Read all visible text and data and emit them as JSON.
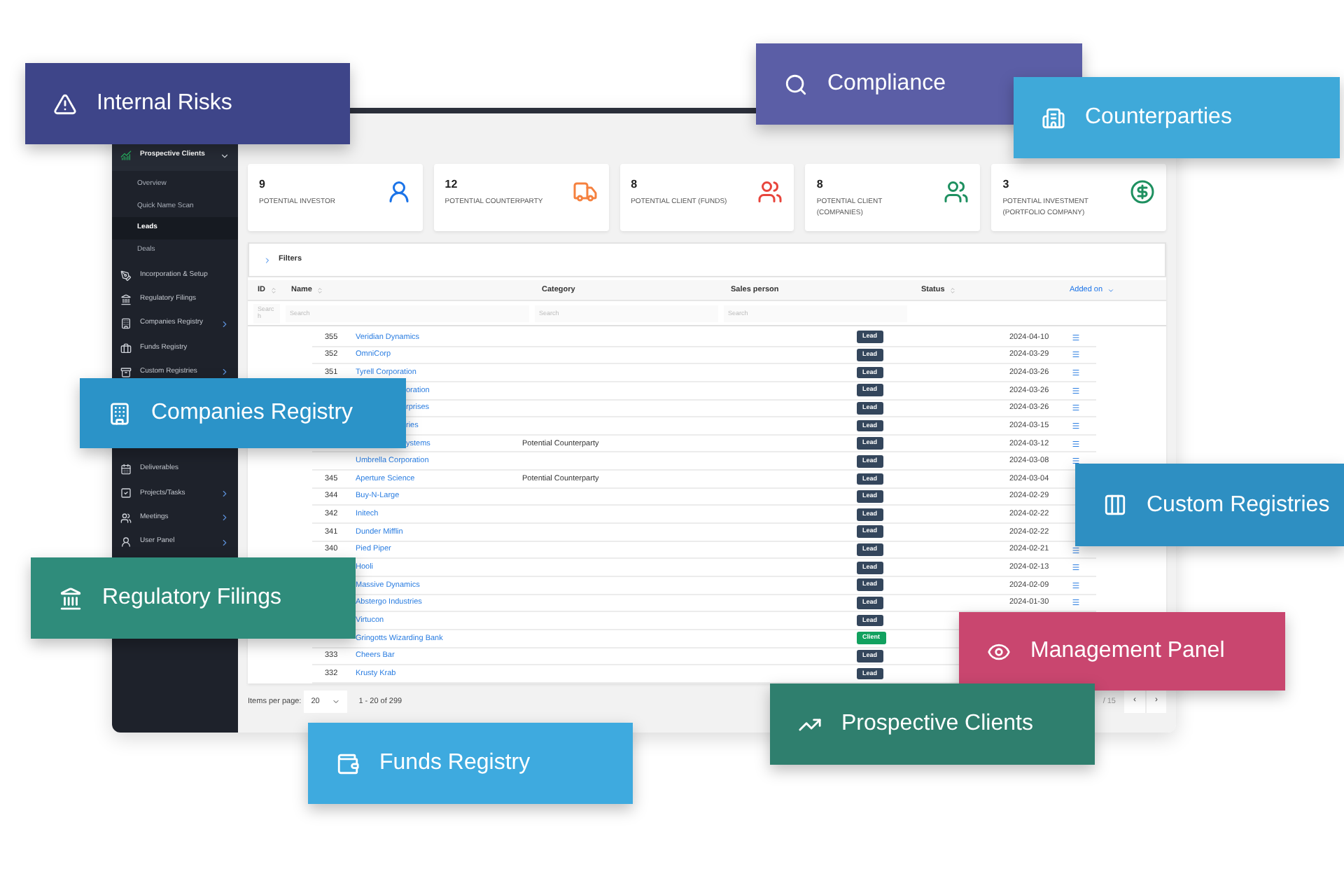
{
  "sidebar": {
    "items": [
      {
        "label": "Prospective Clients",
        "expandable": true,
        "expanded": true,
        "children": [
          {
            "label": "Overview",
            "selected": false
          },
          {
            "label": "Quick Name Scan",
            "selected": false
          },
          {
            "label": "Leads",
            "selected": true
          },
          {
            "label": "Deals",
            "selected": false
          }
        ]
      },
      {
        "label": "Incorporation & Setup",
        "expandable": false,
        "expanded": false
      },
      {
        "label": "Regulatory Filings",
        "expandable": false,
        "expanded": false
      },
      {
        "label": "Companies Registry",
        "expandable": true,
        "expanded": false
      },
      {
        "label": "Funds Registry",
        "expandable": false,
        "expanded": false
      },
      {
        "label": "Custom Registries",
        "expandable": true,
        "expanded": false
      }
    ],
    "bottom_items": [
      {
        "label": "Deliverables",
        "expandable": false,
        "expanded": false
      },
      {
        "label": "Projects/Tasks",
        "expandable": true,
        "expanded": false
      },
      {
        "label": "Meetings",
        "expandable": true,
        "expanded": false
      },
      {
        "label": "User Panel",
        "expandable": true,
        "expanded": false
      }
    ]
  },
  "stats": [
    {
      "value": "9",
      "label": "POTENTIAL INVESTOR"
    },
    {
      "value": "12",
      "label": "POTENTIAL COUNTERPARTY"
    },
    {
      "value": "8",
      "label": "POTENTIAL CLIENT (FUNDS)"
    },
    {
      "value": "8",
      "label": "POTENTIAL CLIENT (COMPANIES)"
    },
    {
      "value": "3",
      "label": "POTENTIAL INVESTMENT (PORTFOLIO COMPANY)"
    }
  ],
  "filters": {
    "label": "Filters",
    "expanded": false
  },
  "table": {
    "columns": [
      {
        "label": "ID",
        "sortable": true,
        "sorted": false,
        "placeholder": "Search"
      },
      {
        "label": "Name",
        "sortable": true,
        "sorted": false,
        "placeholder": "Search"
      },
      {
        "label": "Category",
        "sortable": false,
        "sorted": false,
        "placeholder": "Search"
      },
      {
        "label": "Sales person",
        "sortable": false,
        "sorted": false,
        "placeholder": "Search"
      },
      {
        "label": "Status",
        "sortable": true,
        "sorted": false
      },
      {
        "label": "Added on",
        "sortable": true,
        "sorted": true
      }
    ],
    "rows": [
      {
        "id": "355",
        "name": "Veridian Dynamics",
        "status": {
          "label": "Lead",
          "kind": "lead"
        },
        "date": "2024-04-10",
        "actions": true,
        "clipped": false
      },
      {
        "id": "352",
        "name": "OmniCorp",
        "status": {
          "label": "Lead",
          "kind": "lead"
        },
        "date": "2024-03-29",
        "actions": true,
        "clipped": false
      },
      {
        "id": "351",
        "name": "Tyrell Corporation",
        "status": {
          "label": "Lead",
          "kind": "lead"
        },
        "date": "2024-03-26",
        "actions": true,
        "clipped": false
      },
      {
        "name": "oration",
        "status": {
          "label": "Lead",
          "kind": "lead"
        },
        "date": "2024-03-26",
        "actions": true,
        "clipped": true
      },
      {
        "name": "rprises",
        "status": {
          "label": "Lead",
          "kind": "lead"
        },
        "date": "2024-03-26",
        "actions": true,
        "clipped": true
      },
      {
        "name": "ries",
        "status": {
          "label": "Lead",
          "kind": "lead"
        },
        "date": "2024-03-15",
        "actions": true,
        "clipped": true
      },
      {
        "name": "ystems",
        "category": "Potential Counterparty",
        "status": {
          "label": "Lead",
          "kind": "lead"
        },
        "date": "2024-03-12",
        "actions": true,
        "clipped": true
      },
      {
        "name": "Umbrella Corporation",
        "status": {
          "label": "Lead",
          "kind": "lead"
        },
        "date": "2024-03-08",
        "actions": true,
        "clipped": false
      },
      {
        "id": "345",
        "name": "Aperture Science",
        "category": "Potential Counterparty",
        "status": {
          "label": "Lead",
          "kind": "lead"
        },
        "date": "2024-03-04",
        "actions": false,
        "clipped": false
      },
      {
        "id": "344",
        "name": "Buy-N-Large",
        "status": {
          "label": "Lead",
          "kind": "lead"
        },
        "date": "2024-02-29",
        "actions": false,
        "clipped": false
      },
      {
        "id": "342",
        "name": "Initech",
        "status": {
          "label": "Lead",
          "kind": "lead"
        },
        "date": "2024-02-22",
        "actions": false,
        "clipped": false
      },
      {
        "id": "341",
        "name": "Dunder Mifflin",
        "status": {
          "label": "Lead",
          "kind": "lead"
        },
        "date": "2024-02-22",
        "actions": false,
        "clipped": false
      },
      {
        "id": "340",
        "name": "Pied Piper",
        "status": {
          "label": "Lead",
          "kind": "lead"
        },
        "date": "2024-02-21",
        "actions": true,
        "clipped": false
      },
      {
        "name": "Hooli",
        "status": {
          "label": "Lead",
          "kind": "lead"
        },
        "date": "2024-02-13",
        "actions": true,
        "clipped": false
      },
      {
        "name": "Massive Dynamics",
        "status": {
          "label": "Lead",
          "kind": "lead"
        },
        "date": "2024-02-09",
        "actions": true,
        "clipped": false
      },
      {
        "name": "Abstergo Industries",
        "status": {
          "label": "Lead",
          "kind": "lead"
        },
        "date": "2024-01-30",
        "actions": true,
        "clipped": false
      },
      {
        "name": "Virtucon",
        "status": {
          "label": "Lead",
          "kind": "lead"
        },
        "clipped": false
      },
      {
        "name": "Gringotts Wizarding Bank",
        "status": {
          "label": "Client",
          "kind": "client"
        },
        "clipped": false
      },
      {
        "id": "333",
        "name": "Cheers Bar",
        "status": {
          "label": "Lead",
          "kind": "lead"
        },
        "clipped": false
      },
      {
        "id": "332",
        "name": "Krusty Krab",
        "status": {
          "label": "Lead",
          "kind": "lead"
        },
        "clipped": false
      }
    ]
  },
  "pagination": {
    "items_label": "Items per page:",
    "page_size": "20",
    "range": "1 - 20 of 299",
    "page": "/ 15",
    "prev": "‹",
    "next": "›"
  },
  "feature_cards": [
    {
      "label": "Internal Risks",
      "color": "#3e4589"
    },
    {
      "label": "Compliance",
      "color": "#5b5ea6"
    },
    {
      "label": "Counterparties",
      "color": "#3fa9d9"
    },
    {
      "label": "Companies Registry",
      "color": "#2b93c8"
    },
    {
      "label": "Custom Registries",
      "color": "#2e8fc2"
    },
    {
      "label": "Regulatory Filings",
      "color": "#2f8c7b"
    },
    {
      "label": "Management Panel",
      "color": "#c9466f"
    },
    {
      "label": "Prospective Clients",
      "color": "#2f7f6e"
    },
    {
      "label": "Funds Registry",
      "color": "#3eaadf"
    }
  ]
}
